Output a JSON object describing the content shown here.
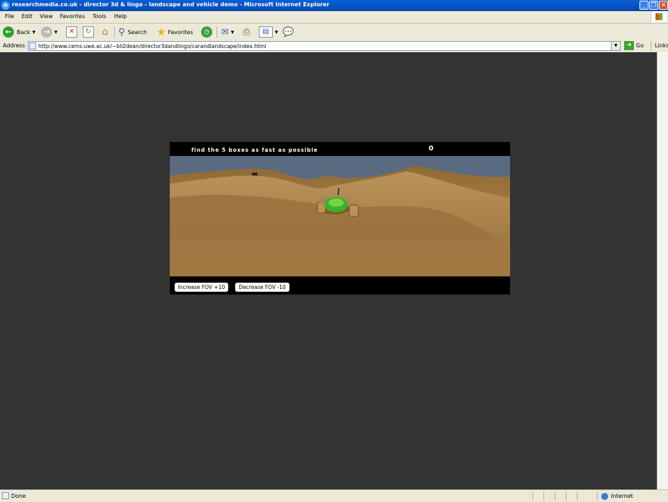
{
  "window": {
    "title": "researchmedia.co.uk - director 3d & lingo - landscape and vehicle demo - Microsoft Internet Explorer"
  },
  "menu": [
    "File",
    "Edit",
    "View",
    "Favorites",
    "Tools",
    "Help"
  ],
  "toolbar": {
    "back_label": "Back",
    "search_label": "Search",
    "favorites_label": "Favorites"
  },
  "address": {
    "label": "Address",
    "url": "http://www.cems.uwe.ac.uk/~bli2dean/director3dandlingo/carandlandscape/index.html",
    "go_label": "Go",
    "links_label": "Links"
  },
  "game": {
    "instruction": "find the 5 boxes as fast as possible",
    "score": "0",
    "increase_fov_label": "Increase FOV +10",
    "decrease_fov_label": "Decrease FOV -10"
  },
  "statusbar": {
    "status": "Done",
    "zone": "Internet"
  },
  "colors": {
    "page_background": "#333333",
    "sky": "#5a6a80",
    "sand": "#a57c42",
    "vehicle": "#3fae2a"
  }
}
